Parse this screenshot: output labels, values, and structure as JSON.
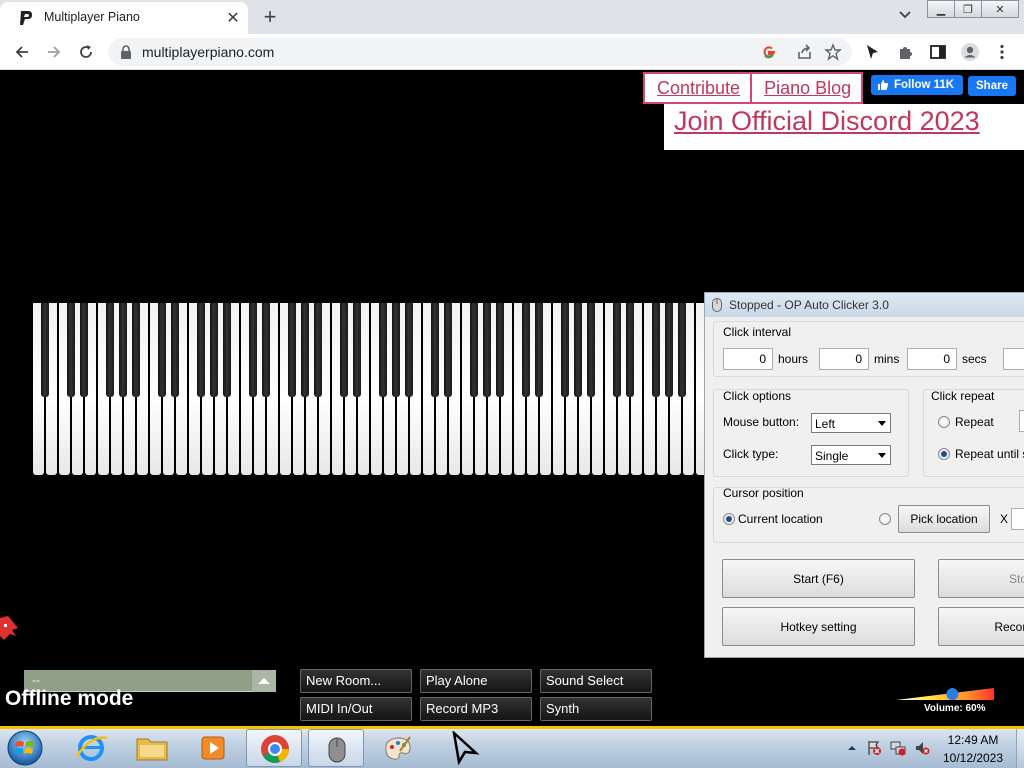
{
  "browser": {
    "tab_title": "Multiplayer Piano",
    "url": "multiplayerpiano.com"
  },
  "site": {
    "links": [
      "Contribute",
      "Piano Blog"
    ],
    "fb_follow": "Follow 11K",
    "fb_share": "Share",
    "discord": "Join Official Discord 2023",
    "room_name": "--",
    "status": "Offline mode",
    "buttons_row1": [
      "New Room...",
      "Play Alone",
      "Sound Select"
    ],
    "buttons_row2": [
      "MIDI In/Out",
      "Record MP3",
      "Synth"
    ],
    "volume": {
      "label": "Volume: 60%",
      "value": 0.6
    }
  },
  "autoclicker": {
    "title": "Stopped - OP Auto Clicker 3.0",
    "click_interval": {
      "label": "Click interval",
      "hours": "0",
      "hours_label": "hours",
      "mins": "0",
      "mins_label": "mins",
      "secs": "0",
      "secs_label": "secs"
    },
    "click_options": {
      "label": "Click options",
      "mouse_button_label": "Mouse button:",
      "mouse_button": "Left",
      "click_type_label": "Click type:",
      "click_type": "Single"
    },
    "click_repeat": {
      "label": "Click repeat",
      "repeat": "Repeat",
      "repeat_until": "Repeat until sto"
    },
    "cursor_position": {
      "label": "Cursor position",
      "current": "Current location",
      "pick": "Pick location",
      "x_label": "X"
    },
    "buttons": {
      "start": "Start (F6)",
      "stop": "Sto",
      "hotkey": "Hotkey setting",
      "record": "Record"
    }
  },
  "taskbar": {
    "time": "12:49 AM",
    "date": "10/12/2023"
  },
  "colors": {
    "accent_pink": "#c0375f",
    "facebook_blue": "#1877f2",
    "taskbar_stripe": "#f4c200"
  }
}
